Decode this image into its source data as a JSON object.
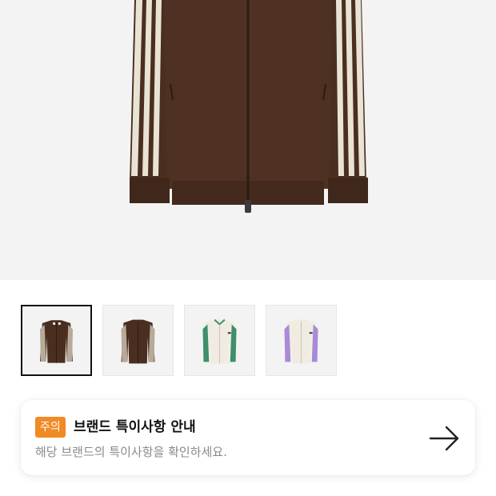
{
  "product": {
    "main_image_icon": "brown-track-jacket-image",
    "colors": {
      "brown": "#4a2e1f",
      "stripe": "#e9e3d6",
      "green": "#3f8f6a",
      "lavender": "#a98ad6",
      "cream": "#f0ece2"
    }
  },
  "thumbnails": [
    {
      "label": "brown-jacket-front",
      "selected": true
    },
    {
      "label": "brown-jacket-back",
      "selected": false
    },
    {
      "label": "cream-green-jacket",
      "selected": false
    },
    {
      "label": "cream-lavender-jacket",
      "selected": false
    }
  ],
  "notice": {
    "badge": "주의",
    "title": "브랜드 특이사항 안내",
    "description": "해당 브랜드의 특이사항을 확인하세요.",
    "arrow_icon": "arrow-right-icon",
    "badge_color": "#f08a24"
  }
}
